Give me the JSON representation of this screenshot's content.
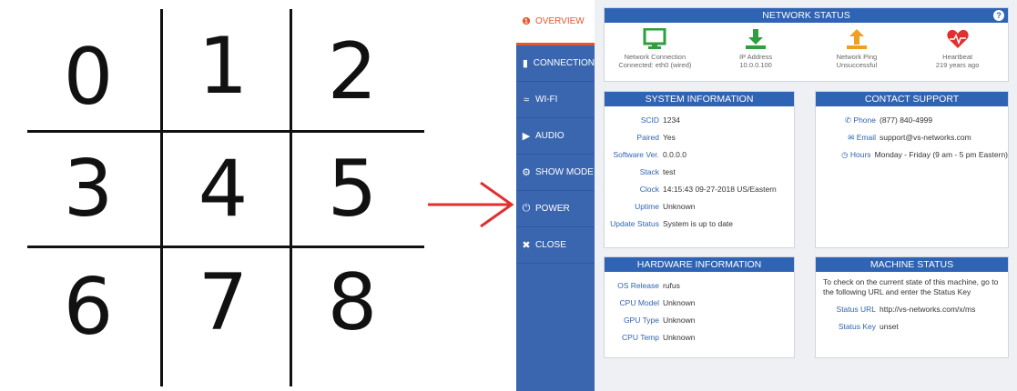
{
  "grid": {
    "digits": [
      "0",
      "1",
      "2",
      "3",
      "4",
      "5",
      "6",
      "7",
      "8"
    ]
  },
  "sidebar": {
    "items": [
      {
        "label": "OVERVIEW",
        "icon": "info-icon",
        "active": true
      },
      {
        "label": "CONNECTION",
        "icon": "signal-bars-icon",
        "active": false
      },
      {
        "label": "WI-FI",
        "icon": "wifi-icon",
        "active": false
      },
      {
        "label": "AUDIO",
        "icon": "speaker-icon",
        "active": false
      },
      {
        "label": "SHOW MODE",
        "icon": "gears-icon",
        "active": false
      },
      {
        "label": "POWER",
        "icon": "power-icon",
        "active": false
      },
      {
        "label": "CLOSE",
        "icon": "close-circle-icon",
        "active": false
      }
    ]
  },
  "network_status": {
    "title": "NETWORK STATUS",
    "help": "?",
    "items": [
      {
        "label": "Network Connection",
        "value": "Connected: eth0 (wired)",
        "icon": "monitor-icon",
        "color": "#2e9e3e"
      },
      {
        "label": "IP Address",
        "value": "10.0.0.100",
        "icon": "download-icon",
        "color": "#2e9e3e"
      },
      {
        "label": "Network Ping",
        "value": "Unsuccessful",
        "icon": "upload-icon",
        "color": "#f0a020"
      },
      {
        "label": "Heartbeat",
        "value": "219 years ago",
        "icon": "heart-icon",
        "color": "#e03030"
      }
    ]
  },
  "system_info": {
    "title": "SYSTEM INFORMATION",
    "rows": [
      {
        "k": "SCID",
        "v": "1234"
      },
      {
        "k": "Paired",
        "v": "Yes"
      },
      {
        "k": "Software Ver.",
        "v": "0.0.0.0"
      },
      {
        "k": "Stack",
        "v": "test"
      },
      {
        "k": "Clock",
        "v": "14:15:43 09-27-2018 US/Eastern"
      },
      {
        "k": "Uptime",
        "v": "Unknown"
      },
      {
        "k": "Update Status",
        "v": "System is up to date"
      }
    ]
  },
  "contact_support": {
    "title": "CONTACT SUPPORT",
    "rows": [
      {
        "k": "Phone",
        "v": "(877) 840-4999",
        "icon": "phone-icon"
      },
      {
        "k": "Email",
        "v": "support@vs-networks.com",
        "icon": "envelope-icon"
      },
      {
        "k": "Hours",
        "v": "Monday - Friday (9 am - 5 pm Eastern)",
        "icon": "clock-icon"
      }
    ]
  },
  "hardware_info": {
    "title": "HARDWARE INFORMATION",
    "rows": [
      {
        "k": "OS Release",
        "v": "rufus"
      },
      {
        "k": "CPU Model",
        "v": "Unknown"
      },
      {
        "k": "GPU Type",
        "v": "Unknown"
      },
      {
        "k": "CPU Temp",
        "v": "Unknown"
      }
    ]
  },
  "machine_status": {
    "title": "MACHINE STATUS",
    "text": "To check on the current state of this machine, go to the following URL and enter the Status Key",
    "rows": [
      {
        "k": "Status URL",
        "v": "http://vs-networks.com/x/ms"
      },
      {
        "k": "Status Key",
        "v": "unset"
      }
    ]
  },
  "colors": {
    "accent": "#2f63b3",
    "sidebar": "#3a66b0",
    "active": "#e8552a",
    "arrow": "#e03030"
  }
}
